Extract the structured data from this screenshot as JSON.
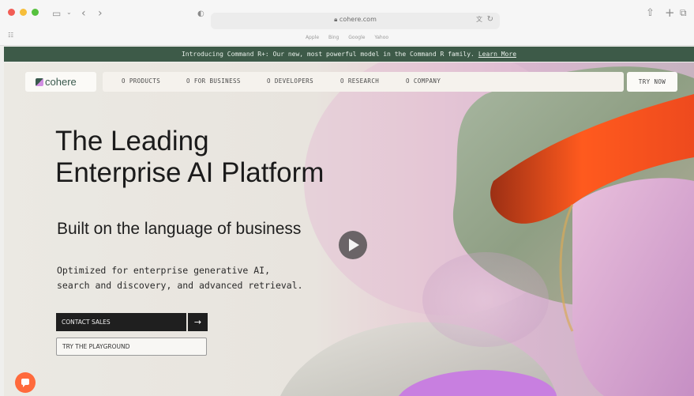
{
  "browser": {
    "url": "cohere.com",
    "favorites": [
      "Apple",
      "Bing",
      "Google",
      "Yahoo"
    ]
  },
  "announcement": {
    "text": "Introducing Command R+: Our new, most powerful model in the Command R family.",
    "link": "Learn More"
  },
  "nav": {
    "logo": "cohere",
    "items": [
      "O PRODUCTS",
      "O FOR BUSINESS",
      "O DEVELOPERS",
      "O RESEARCH",
      "O COMPANY"
    ],
    "cta": "TRY NOW"
  },
  "hero": {
    "title_line1": "The Leading",
    "title_line2": "Enterprise AI Platform",
    "subtitle": "Built on the language of business",
    "desc_line1": "Optimized for enterprise generative AI,",
    "desc_line2": "search and discovery, and advanced retrieval.",
    "contact_sales": "CONTACT SALES",
    "try_playground": "TRY THE PLAYGROUND"
  },
  "colors": {
    "announcement_bg": "#3d5a48",
    "accent_orange": "#ff6a3c",
    "brand_green": "#39594d"
  }
}
